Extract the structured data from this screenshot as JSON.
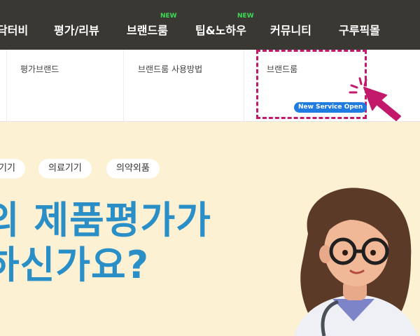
{
  "nav": {
    "items": [
      "닥터비",
      "평가/리뷰",
      "브랜드룸",
      "팁&노하우",
      "커뮤니티",
      "구루픽몰"
    ],
    "new_badges": [
      "NEW",
      "NEW"
    ]
  },
  "submenu": {
    "items": [
      "평가브랜드",
      "브랜드룸 사용방법",
      "브랜드룸"
    ],
    "badge": "New Service Open"
  },
  "hero": {
    "categories": [
      "기기",
      "의료기기",
      "의약외품"
    ],
    "headline_line1": "의 제품평가가",
    "headline_line2": "하신가요?"
  },
  "colors": {
    "nav_bg": "#3a3833",
    "highlight": "#c2196b",
    "badge": "#1f7be0",
    "hero_bg": "#fdf1d4",
    "headline": "#2a8ec7",
    "new_label": "#3ddc57"
  },
  "icons": [
    "pointer-arrow-icon",
    "doctor-illustration"
  ]
}
